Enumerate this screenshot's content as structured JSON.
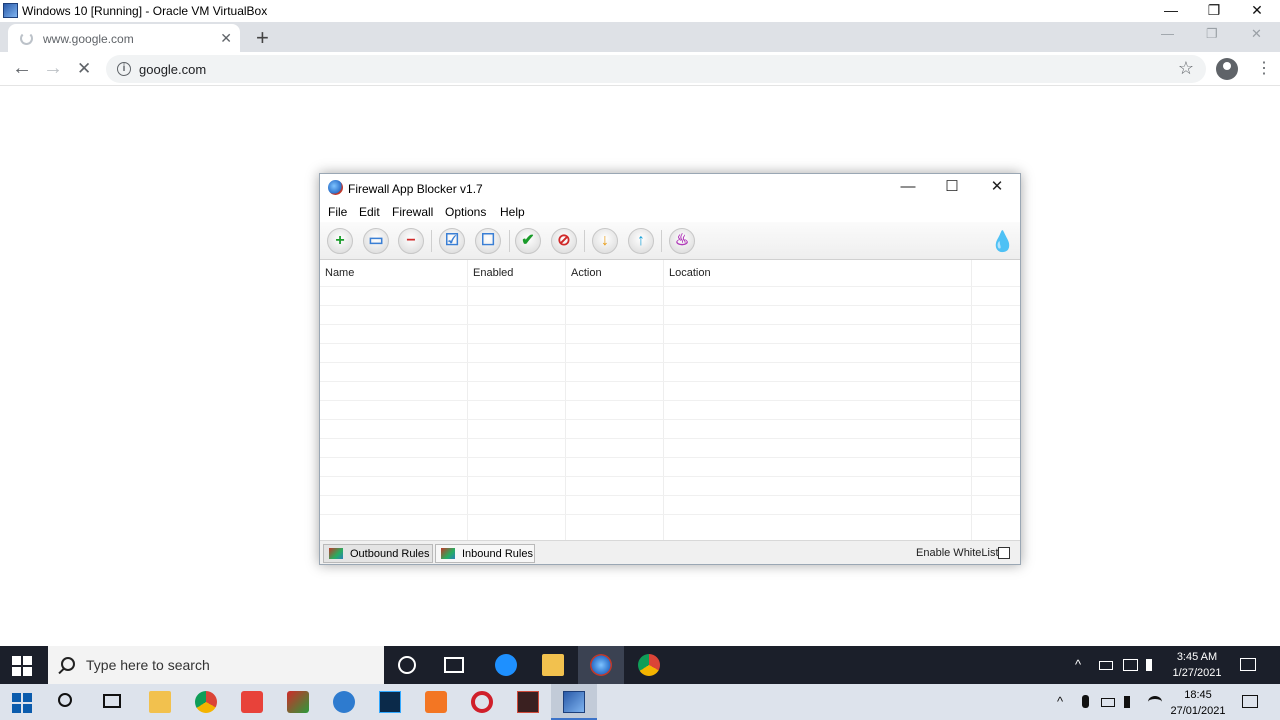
{
  "vbox": {
    "title": "Windows 10 [Running] - Oracle VM VirtualBox",
    "min": "—",
    "restore": "❐",
    "close": "✕"
  },
  "chrome": {
    "tab_label": "www.google.com",
    "tab_close": "✕",
    "new_tab": "+",
    "win_min": "—",
    "win_restore": "❐",
    "win_close": "✕",
    "back": "←",
    "forward": "→",
    "stop": "✕",
    "url": "google.com",
    "info_glyph": "i",
    "star": "☆",
    "menu": "⋮"
  },
  "fab": {
    "title": "Firewall App Blocker v1.7",
    "min": "—",
    "max": "☐",
    "close": "✕",
    "menu": [
      "File",
      "Edit",
      "Firewall",
      "Options",
      "Help"
    ],
    "toolbar": [
      {
        "name": "add-icon",
        "glyph": "+",
        "color": "#1a9b2a"
      },
      {
        "name": "monitor-icon",
        "glyph": "▭",
        "color": "#3a7fd5"
      },
      {
        "name": "remove-icon",
        "glyph": "−",
        "color": "#d02a2a"
      },
      {
        "name": "check-all-icon",
        "glyph": "☑",
        "color": "#3a7fd5"
      },
      {
        "name": "uncheck-all-icon",
        "glyph": "☐",
        "color": "#3a7fd5"
      },
      {
        "name": "allow-icon",
        "glyph": "✔",
        "color": "#1a9b2a"
      },
      {
        "name": "block-icon",
        "glyph": "⊘",
        "color": "#d02a2a"
      },
      {
        "name": "import-icon",
        "glyph": "↓",
        "color": "#e89b12"
      },
      {
        "name": "export-icon",
        "glyph": "↑",
        "color": "#18a0d8"
      },
      {
        "name": "flame-icon",
        "glyph": "♨",
        "color": "#b03ab8"
      }
    ],
    "brand_glyph": "💧",
    "columns": [
      "Name",
      "Enabled",
      "Action",
      "Location"
    ],
    "tabs": [
      "Outbound Rules",
      "Inbound Rules"
    ],
    "whitelist_label": "Enable WhiteList",
    "whitelist_checked": false
  },
  "guest_taskbar": {
    "search_placeholder": "Type here to search",
    "time": "3:45 AM",
    "date": "1/27/2021",
    "tray_up": "^",
    "notif": "▭"
  },
  "host_taskbar": {
    "time": "18:45",
    "date": "27/01/2021",
    "tray_up": "^",
    "notif": "▭"
  }
}
